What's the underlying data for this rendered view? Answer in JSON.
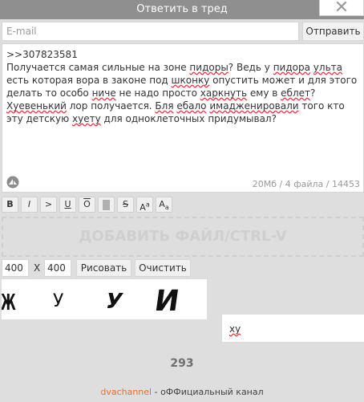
{
  "dialog": {
    "title": "Ответить в тред",
    "close_glyph": "✕"
  },
  "email": {
    "placeholder": "E-mail"
  },
  "send_label": "Отправить",
  "message": {
    "line1": ">>307823581",
    "p1": "Получается самая сильные на зоне ",
    "w1": "пидоры",
    "p2": "? Ведь у ",
    "w2": "пидора",
    "p3": " ",
    "w3": "ульта",
    "p4": " есть которая вора в законе под ",
    "w4": "шконку",
    "p5": " опустить может и для этого делать то особо ",
    "w5": "ниче",
    "p6": " не надо просто ",
    "w6": "харкнуть",
    "p7": " ему в ",
    "w7": "еблет",
    "p8": "? ",
    "w8": "Хуевенький",
    "p9": " лор получается. ",
    "w9": "Бля",
    "p10": " ",
    "w10": "ебало",
    "p11": " ",
    "w11": "имадженировали",
    "p12": " того кто эту детскую ",
    "w12": "хуету",
    "p13": " для одноклеточных придумывал?"
  },
  "counter": "20Мб / 4 файла / 14453",
  "format_buttons": [
    "B",
    "I",
    ">",
    "U",
    "O",
    "",
    "S",
    "Aa",
    "Aa"
  ],
  "dropzone_label": "ДОБАВИТЬ ФАЙЛ/CTRL-V",
  "canvas_size": {
    "width": "400",
    "height": "400",
    "separator": "X"
  },
  "draw_label": "Рисовать",
  "clear_label": "Очистить",
  "captcha": {
    "glyphs": [
      "Ж",
      "У",
      "У",
      "И"
    ]
  },
  "captcha_input_value": "ху",
  "page_number": "293",
  "footer": {
    "link": "dvachannel",
    "suffix": " - оФФициальный канал"
  },
  "colors": {
    "titlebar": "#8f8f8f",
    "accent_link": "#e6722d",
    "background": "#dedede"
  }
}
